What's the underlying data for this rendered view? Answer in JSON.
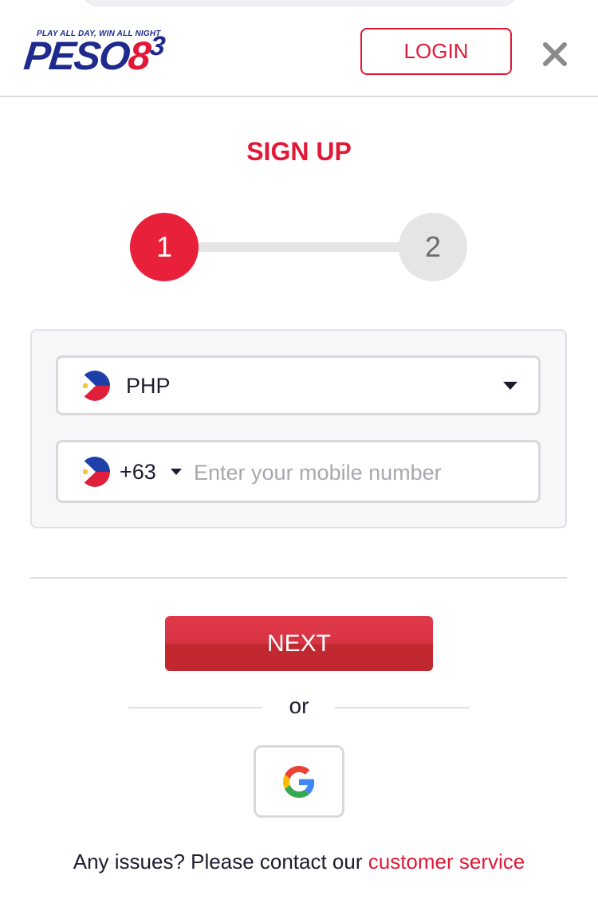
{
  "header": {
    "logo": {
      "tagline": "PLAY ALL DAY, WIN ALL NIGHT",
      "word": "PESO",
      "number": "8",
      "superscript": "3"
    },
    "login_label": "LOGIN",
    "close_icon": "close-icon"
  },
  "signup": {
    "title": "SIGN UP",
    "steps": [
      {
        "label": "1",
        "state": "active"
      },
      {
        "label": "2",
        "state": "inactive"
      }
    ]
  },
  "form": {
    "currency": {
      "flag_icon": "philippines-flag-icon",
      "value": "PHP"
    },
    "phone": {
      "flag_icon": "philippines-flag-icon",
      "dial_code": "+63",
      "value": "",
      "placeholder": "Enter your mobile number"
    }
  },
  "actions": {
    "next_label": "NEXT",
    "or_label": "or",
    "google_icon": "google-icon"
  },
  "footer": {
    "text": "Any issues? Please contact our ",
    "link_label": "customer service"
  },
  "colors": {
    "brand_red": "#e21836",
    "brand_blue": "#1e2a8c",
    "inactive_gray": "#e5e5e5"
  }
}
